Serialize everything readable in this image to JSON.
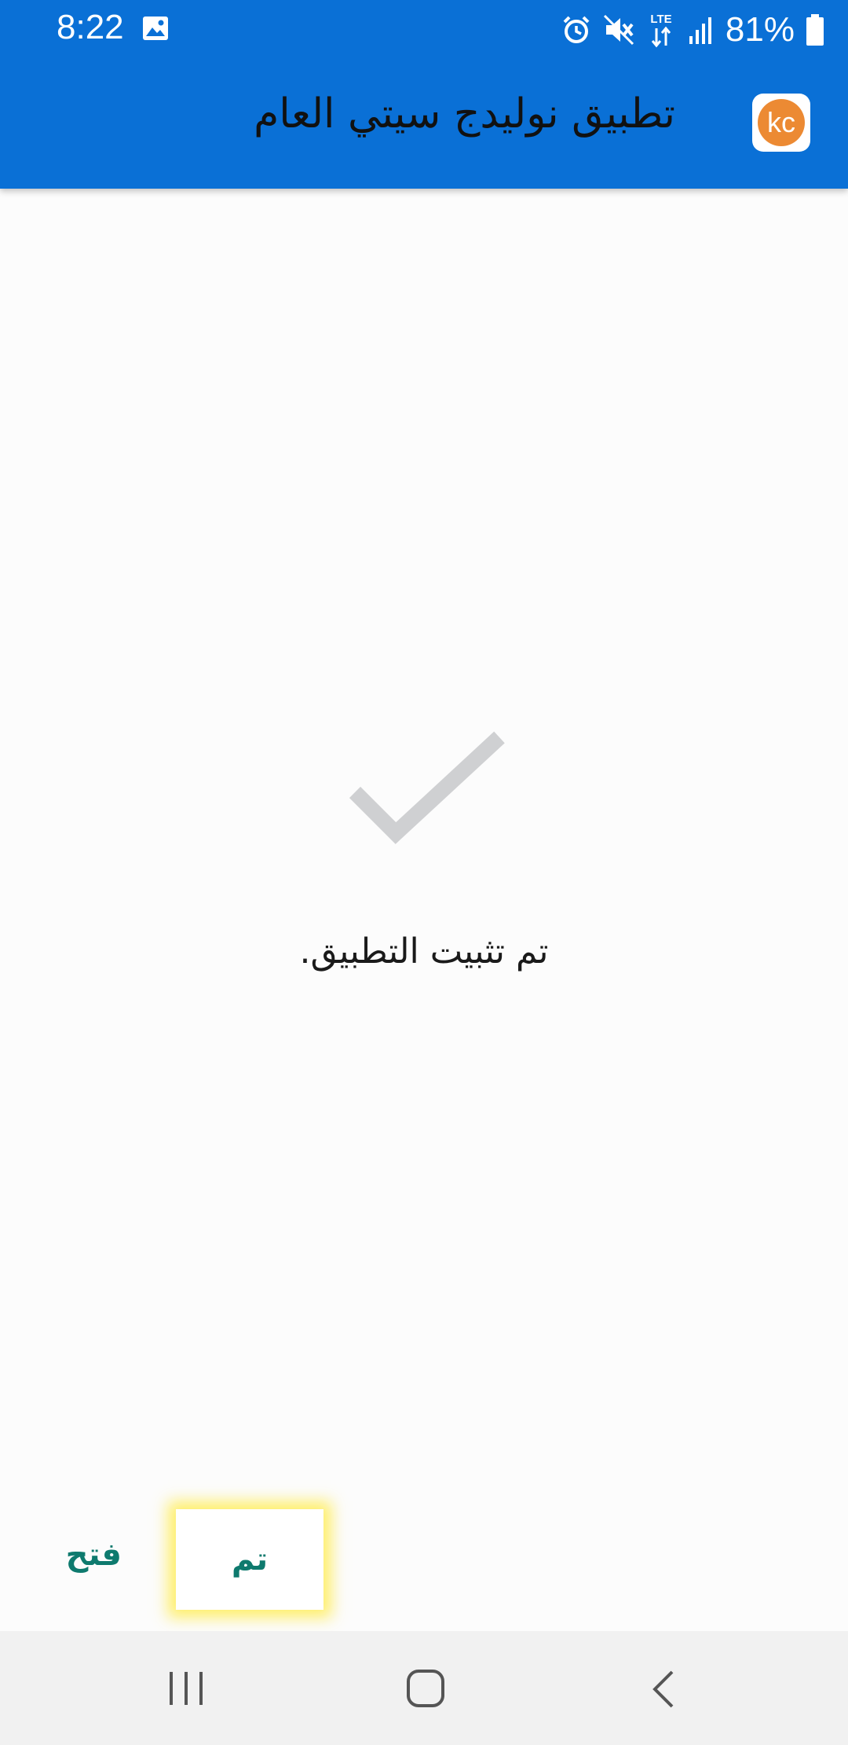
{
  "status_bar": {
    "time": "8:22",
    "battery_percent": "81%",
    "network_label": "LTE",
    "icons": [
      "image-icon",
      "alarm-icon",
      "mute-icon",
      "lte-icon",
      "signal-icon",
      "battery-icon"
    ]
  },
  "header": {
    "title": "تطبيق نوليدج سيتي العام",
    "app_icon_text": "kc"
  },
  "main": {
    "status_icon": "checkmark-icon",
    "message": "تم تثبيت التطبيق."
  },
  "actions": {
    "open_label": "فتح",
    "done_label": "تم"
  },
  "navigation": {
    "recent_icon": "recent-apps-icon",
    "home_icon": "home-icon",
    "back_icon": "back-icon"
  },
  "colors": {
    "header_blue": "#0a70d6",
    "accent_teal": "#0e7a6e",
    "check_gray": "#cfd0d2",
    "highlight_yellow": "#ffec50",
    "app_icon_orange": "#ec8a33"
  }
}
